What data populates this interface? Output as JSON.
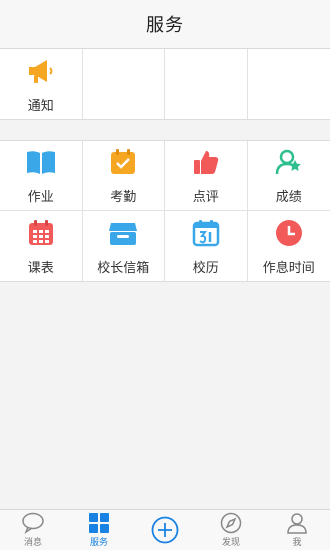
{
  "header": {
    "title": "服务"
  },
  "section1": [
    {
      "label": "通知",
      "icon": "megaphone-icon",
      "color": "#f5a623"
    },
    {
      "label": "",
      "icon": ""
    },
    {
      "label": "",
      "icon": ""
    },
    {
      "label": "",
      "icon": ""
    }
  ],
  "section2": [
    {
      "label": "作业",
      "icon": "book-icon",
      "color": "#3aa7e8"
    },
    {
      "label": "考勤",
      "icon": "calendar-check-icon",
      "color": "#f5a623"
    },
    {
      "label": "点评",
      "icon": "thumbs-up-icon",
      "color": "#f25a5a"
    },
    {
      "label": "成绩",
      "icon": "user-star-icon",
      "color": "#2fbf8f"
    },
    {
      "label": "课表",
      "icon": "schedule-grid-icon",
      "color": "#f25a5a"
    },
    {
      "label": "校长信箱",
      "icon": "mailbox-icon",
      "color": "#3aa7e8"
    },
    {
      "label": "校历",
      "icon": "calendar-31-icon",
      "color": "#3aa7e8"
    },
    {
      "label": "作息时间",
      "icon": "clock-icon",
      "color": "#f25a5a"
    }
  ],
  "tabs": [
    {
      "label": "消息",
      "icon": "chat-bubble-icon",
      "active": false
    },
    {
      "label": "服务",
      "icon": "grid-icon",
      "active": true
    },
    {
      "label": "",
      "icon": "plus-circle-icon",
      "active": false
    },
    {
      "label": "发现",
      "icon": "compass-icon",
      "active": false
    },
    {
      "label": "我",
      "icon": "person-icon",
      "active": false
    }
  ],
  "colors": {
    "accent": "#1a82e2"
  }
}
